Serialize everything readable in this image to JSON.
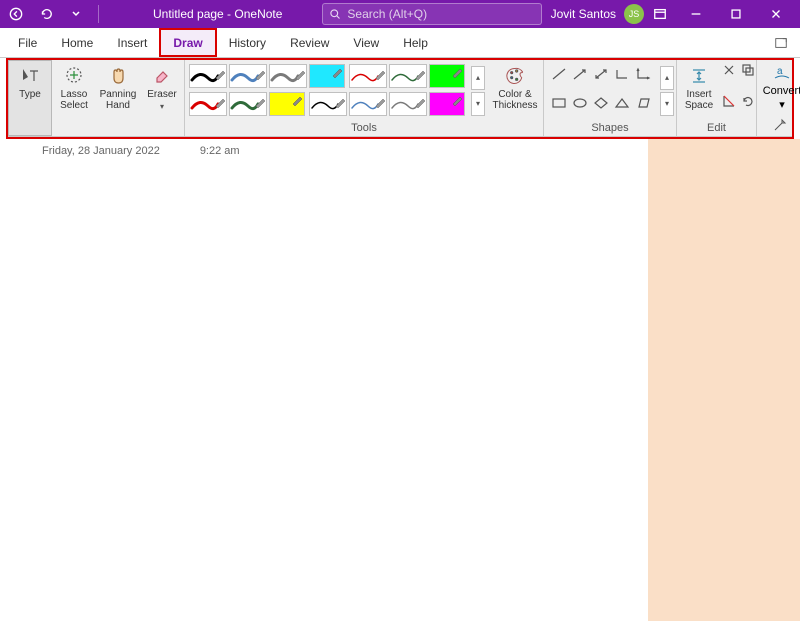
{
  "title": "Untitled page  -  OneNote",
  "search_placeholder": "Search (Alt+Q)",
  "user": {
    "name": "Jovit Santos",
    "initials": "JS"
  },
  "menu": {
    "items": [
      "File",
      "Home",
      "Insert",
      "Draw",
      "History",
      "Review",
      "View",
      "Help"
    ],
    "active_index": 3
  },
  "ribbon": {
    "tools_left": [
      {
        "label": "Type",
        "icon": "cursor-text-icon",
        "selected": true
      },
      {
        "label": "Lasso\nSelect",
        "icon": "lasso-icon"
      },
      {
        "label": "Panning\nHand",
        "icon": "hand-icon"
      },
      {
        "label": "Eraser",
        "icon": "eraser-icon",
        "dropdown": true
      }
    ],
    "pens": [
      {
        "type": "pen",
        "color": "#000000"
      },
      {
        "type": "pen",
        "color": "#d90000"
      },
      {
        "type": "pen",
        "color": "#4f81bd"
      },
      {
        "type": "pen",
        "color": "#2f6b3a"
      },
      {
        "type": "pen",
        "color": "#7a7a7a"
      },
      {
        "type": "hl",
        "color": "#ffff00"
      },
      {
        "type": "hl",
        "color": "#1fe8ff"
      },
      {
        "type": "pen-thin",
        "color": "#000000"
      },
      {
        "type": "pen-thin",
        "color": "#d90000"
      },
      {
        "type": "pen-thin",
        "color": "#4f81bd"
      },
      {
        "type": "pen-thin",
        "color": "#2f6b3a"
      },
      {
        "type": "pen-thin",
        "color": "#7a7a7a"
      },
      {
        "type": "hl",
        "color": "#00ff00"
      },
      {
        "type": "hl",
        "color": "#ff00ff"
      }
    ],
    "color_thickness": "Color &\nThickness",
    "group_labels": {
      "tools": "Tools",
      "shapes": "Shapes",
      "edit": "Edit"
    },
    "insert_space": "Insert\nSpace",
    "convert": "Convert"
  },
  "page": {
    "date": "Friday, 28 January 2022",
    "time": "9:22 am"
  }
}
